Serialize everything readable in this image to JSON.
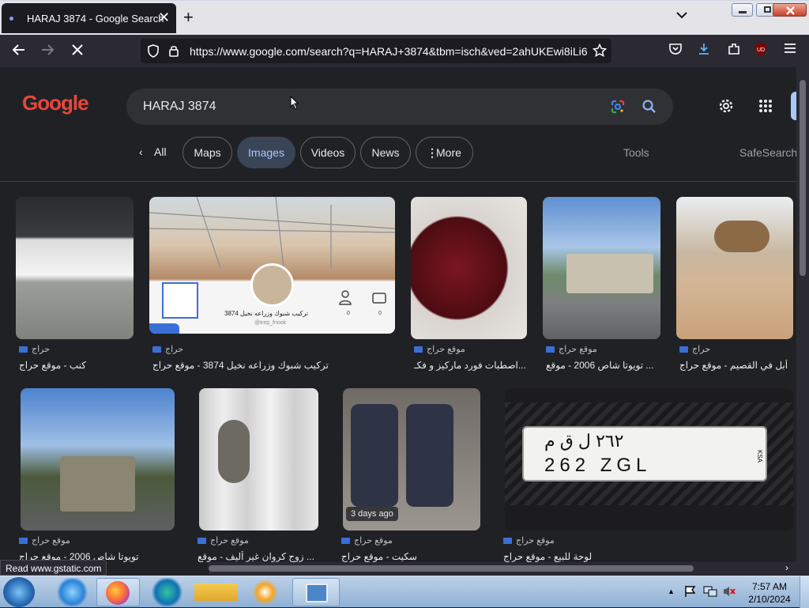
{
  "browser": {
    "tab_title": "HARAJ 3874 - Google Search",
    "tab_close": "✕",
    "new_tab": "+",
    "tab_list": "⌄",
    "url": "https://www.google.com/search?q=HARAJ+3874&tbm=isch&ved=2ahUKEwi8iLi6"
  },
  "search": {
    "logo_text": "Google",
    "query": "HARAJ 3874",
    "tabs": [
      {
        "label": "All"
      },
      {
        "label": "Maps"
      },
      {
        "label": "Images"
      },
      {
        "label": "Videos"
      },
      {
        "label": "News"
      },
      {
        "label": "More"
      }
    ],
    "tools_label": "Tools",
    "safesearch_label": "SafeSearch"
  },
  "results": [
    {
      "source": "حراج",
      "title": "كنب - موقع حراج"
    },
    {
      "source": "حراج",
      "title": "تركيب شبوك وزراعه نخيل 3874 - موقع حراج",
      "overlay_caption": "تركيب شبوك وزراعه نخيل 3874",
      "overlay_handle": "@trep_fnook",
      "overlay_count_a": "0",
      "overlay_count_b": "0"
    },
    {
      "source": "موقع حراج",
      "title": "اصطبات فورد ماركيز و فكـ..."
    },
    {
      "source": "موقع حراج",
      "title": "تويوتا شاص 2006 - موقع ..."
    },
    {
      "source": "حراج",
      "title": "أبل في القصيم - موقع حراج"
    },
    {
      "source": "موقع حراج",
      "title": "تويوتا شاص 2006 - موقع حراج"
    },
    {
      "source": "موقع حراج",
      "title": "زوج كروان غير أليف - موقع ..."
    },
    {
      "source": "موقع حراج",
      "title": "سكيت - موقع حراج",
      "badge": "3 days ago"
    },
    {
      "source": "موقع حراج",
      "title": "لوحة للبيع - موقع حراج",
      "plate_top": "٢٦٢ ل ق م",
      "plate_bottom": "262 ZGL",
      "plate_country": "KSA"
    }
  ],
  "status_text": "Read www.gstatic.com",
  "taskbar": {
    "time": "7:57 AM",
    "date": "2/10/2024"
  },
  "colors": {
    "page_bg": "#202124",
    "active_chip": "#394457",
    "accent_blue": "#a8c7fa"
  }
}
